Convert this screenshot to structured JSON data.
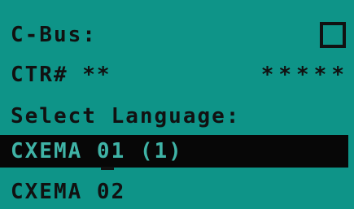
{
  "display": {
    "bus_label": "C-Bus:",
    "ctr_label": "CTR# **",
    "ctr_value": "*****",
    "prompt": "Select Language:",
    "options": [
      {
        "label": "CXEMA 01 (1)",
        "selected": true
      },
      {
        "label": "CXEMA 02",
        "selected": false
      }
    ]
  },
  "colors": {
    "background": "#0e9488",
    "text": "#111111",
    "highlight_bg": "#070707",
    "highlight_text": "#3fb3a6"
  }
}
